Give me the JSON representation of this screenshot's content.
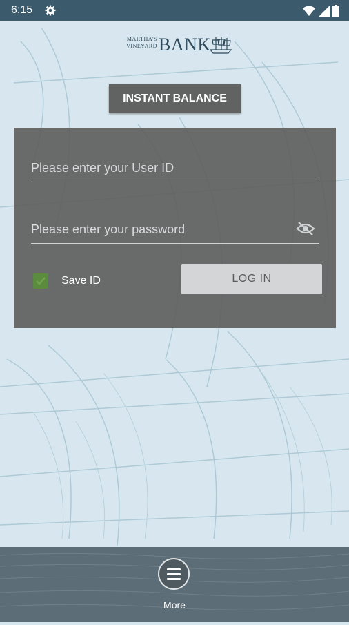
{
  "status_bar": {
    "time": "6:15"
  },
  "logo": {
    "line1": "MARTHA'S",
    "line2": "VINEYARD",
    "bank": "BANK"
  },
  "instant_balance": {
    "label": "INSTANT BALANCE"
  },
  "login_form": {
    "user_id_placeholder": "Please enter your User ID",
    "password_placeholder": "Please enter your password",
    "save_id_label": "Save ID",
    "save_id_checked": true,
    "login_label": "LOG IN"
  },
  "footer": {
    "more_label": "More"
  },
  "icons": [
    "settings-icon",
    "wifi-icon",
    "signal-icon",
    "battery-icon",
    "eye-off-icon",
    "check-icon",
    "menu-icon",
    "ship-icon"
  ],
  "colors": {
    "status_bar": "#3b5a6b",
    "panel": "#606060",
    "checkbox": "#5a8b3f",
    "login_button": "#d3d5d6"
  }
}
